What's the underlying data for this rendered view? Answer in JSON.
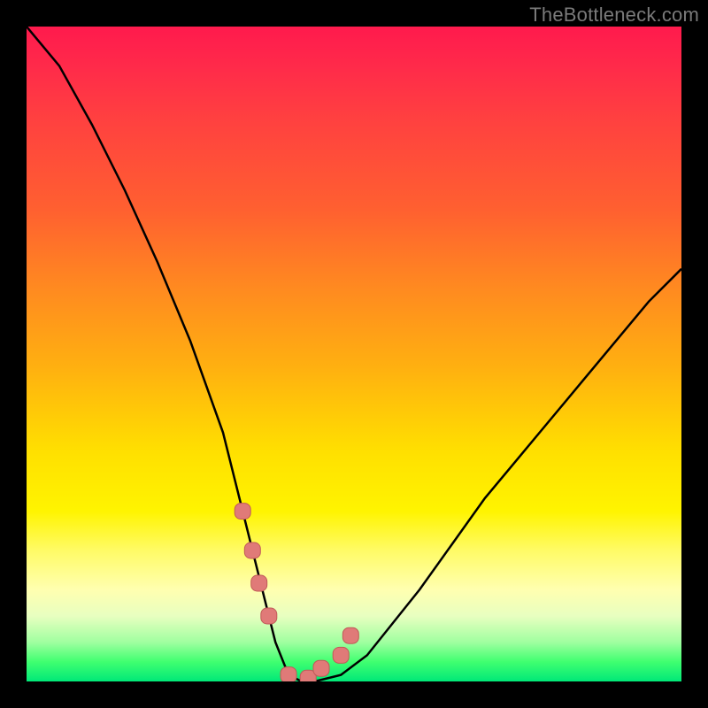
{
  "watermark": "TheBottleneck.com",
  "chart_data": {
    "type": "line",
    "title": "",
    "xlabel": "",
    "ylabel": "",
    "xlim": [
      0,
      100
    ],
    "ylim": [
      0,
      100
    ],
    "series": [
      {
        "name": "bottleneck-curve",
        "x": [
          0,
          5,
          10,
          15,
          20,
          25,
          30,
          33,
          36,
          38,
          40,
          42,
          44,
          48,
          52,
          56,
          60,
          65,
          70,
          75,
          80,
          85,
          90,
          95,
          100
        ],
        "values": [
          100,
          94,
          85,
          75,
          64,
          52,
          38,
          26,
          14,
          6,
          1,
          0,
          0,
          1,
          4,
          9,
          14,
          21,
          28,
          34,
          40,
          46,
          52,
          58,
          63
        ]
      }
    ],
    "markers": {
      "name": "highlight-markers",
      "x": [
        33.0,
        34.5,
        35.5,
        37.0,
        40.0,
        43.0,
        45.0,
        48.0,
        49.5
      ],
      "values": [
        26,
        20,
        15,
        10,
        1,
        0.5,
        2,
        4,
        7
      ]
    }
  },
  "colors": {
    "curve": "#000000",
    "marker_fill": "#e07a78",
    "marker_stroke": "#c05a58"
  }
}
